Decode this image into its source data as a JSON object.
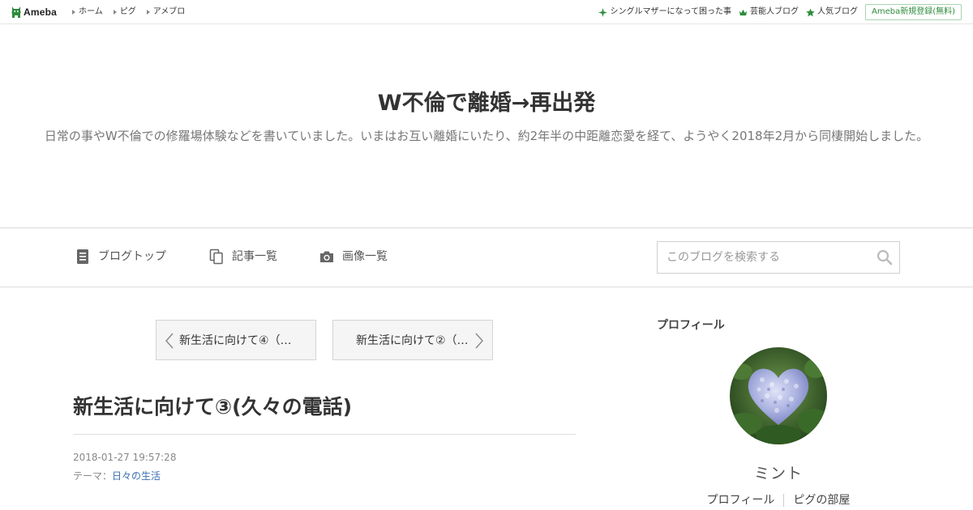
{
  "topbar": {
    "logo_text": "Ameba",
    "nav": [
      {
        "label": "ホーム"
      },
      {
        "label": "ピグ"
      },
      {
        "label": "アメブロ"
      }
    ],
    "right_links": [
      {
        "label": "シングルマザーになって困った事",
        "icon": "sparkle-icon"
      },
      {
        "label": "芸能人ブログ",
        "icon": "crown-icon"
      },
      {
        "label": "人気ブログ",
        "icon": "star-icon"
      }
    ],
    "signup_label": "Ameba新規登録(無料)"
  },
  "header": {
    "title": "W不倫で離婚→再出発",
    "description": "日常の事やW不倫での修羅場体験などを書いていました。いまはお互い離婚にいたり、約2年半の中距離恋愛を経て、ようやく2018年2月から同棲開始しました。"
  },
  "nav": {
    "blog_top": "ブログトップ",
    "articles": "記事一覧",
    "images": "画像一覧"
  },
  "search": {
    "placeholder": "このブログを検索する",
    "value": ""
  },
  "pager": {
    "prev_label": "新生活に向けて④（…",
    "next_label": "新生活に向けて②（…"
  },
  "entry": {
    "title": "新生活に向けて③(久々の電話)",
    "date": "2018-01-27 19:57:28",
    "theme_prefix": "テーマ：",
    "theme": "日々の生活"
  },
  "sidebar": {
    "heading": "プロフィール",
    "name": "ミント",
    "links": [
      {
        "label": "プロフィール"
      },
      {
        "label": "ピグの部屋"
      }
    ]
  },
  "colors": {
    "accent_green": "#2d8c3c",
    "link_blue": "#3a6fb0",
    "text": "#333333",
    "muted": "#777777"
  }
}
